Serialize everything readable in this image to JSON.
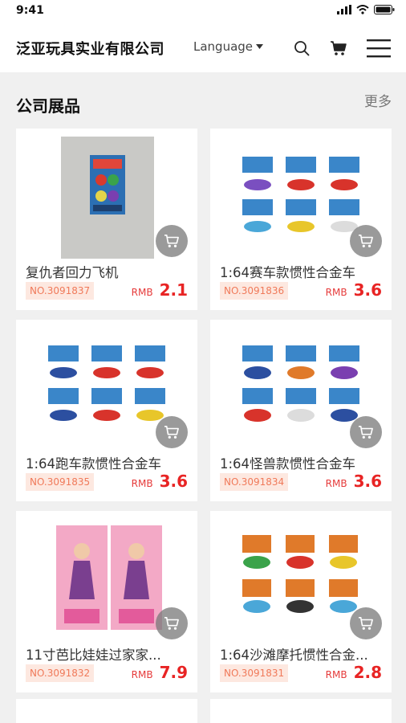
{
  "status_bar": {
    "time": "9:41"
  },
  "header": {
    "brand": "泛亚玩具实业有限公司",
    "language_label": "Language"
  },
  "section": {
    "title": "公司展品",
    "more": "更多"
  },
  "colors": {
    "price": "#e82424",
    "number_tag_bg": "#fde8e0",
    "number_tag_text": "#f07a5a"
  },
  "products": [
    {
      "name": "复仇者回力飞机",
      "number": "NO.3091837",
      "currency": "RMB",
      "price": "2.1"
    },
    {
      "name": "1:64赛车款惯性合金车",
      "number": "NO.3091836",
      "currency": "RMB",
      "price": "3.6"
    },
    {
      "name": "1:64跑车款惯性合金车",
      "number": "NO.3091835",
      "currency": "RMB",
      "price": "3.6"
    },
    {
      "name": "1:64怪兽款惯性合金车",
      "number": "NO.3091834",
      "currency": "RMB",
      "price": "3.6"
    },
    {
      "name": "11寸芭比娃娃过家家...",
      "number": "NO.3091832",
      "currency": "RMB",
      "price": "7.9"
    },
    {
      "name": "1:64沙滩摩托惯性合金...",
      "number": "NO.3091831",
      "currency": "RMB",
      "price": "2.8"
    }
  ]
}
